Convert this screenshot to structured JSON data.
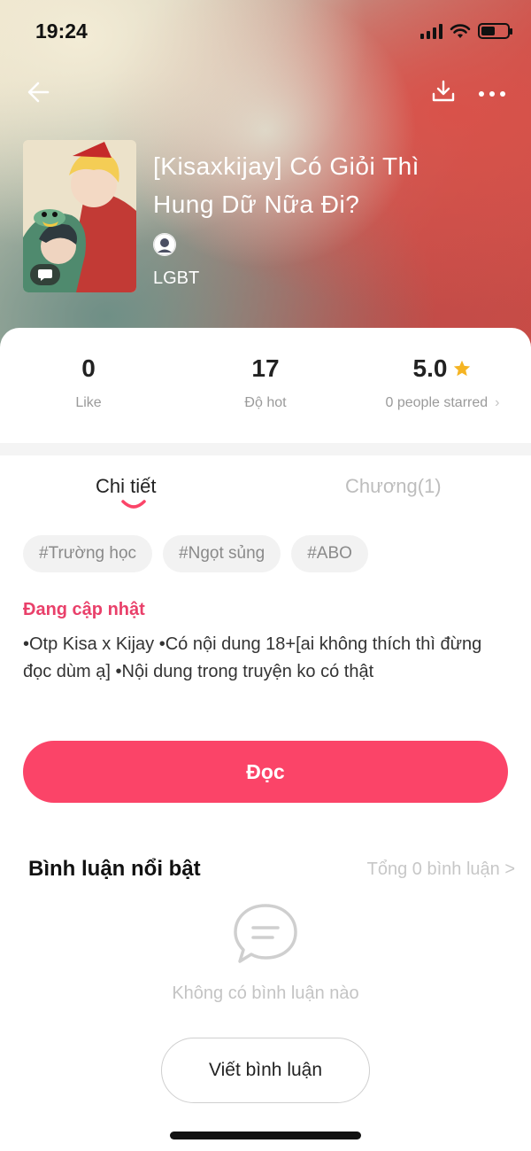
{
  "status_bar": {
    "time": "19:24",
    "battery_level": 0.55
  },
  "nav": {
    "back_icon": "arrow-left-icon",
    "download_icon": "download-icon",
    "more_icon": "more-dots-icon"
  },
  "story": {
    "title_line1": "[Kisaxkijay] Có Giỏi Thì",
    "title_line2": "Hung Dữ Nữa Đi?",
    "category": "LGBT"
  },
  "stats": {
    "likes_value": "0",
    "likes_label": "Like",
    "hot_value": "17",
    "hot_label": "Độ hot",
    "rating_value": "5.0",
    "rating_label": "0 people starred",
    "rating_chevron": "›"
  },
  "tabs": {
    "detail": "Chi tiết",
    "chapters": "Chương(1)"
  },
  "tags": [
    "#Trường học",
    "#Ngọt sủng",
    "#ABO"
  ],
  "status_text": "Đang cập nhật",
  "description": "•Otp Kisa x Kijay  •Có nội dung 18+[ai không thích thì đừng đọc dùm ạ]  •Nội dung trong truyện ko có thật",
  "read_button": "Đọc",
  "comments": {
    "title": "Bình luận nổi bật",
    "total": "Tổng 0 bình luận >",
    "empty": "Không có bình luận nào",
    "write_button": "Viết bình luận"
  },
  "colors": {
    "accent": "#fb4468",
    "status_pink": "#e9406a",
    "star": "#f5b423"
  }
}
